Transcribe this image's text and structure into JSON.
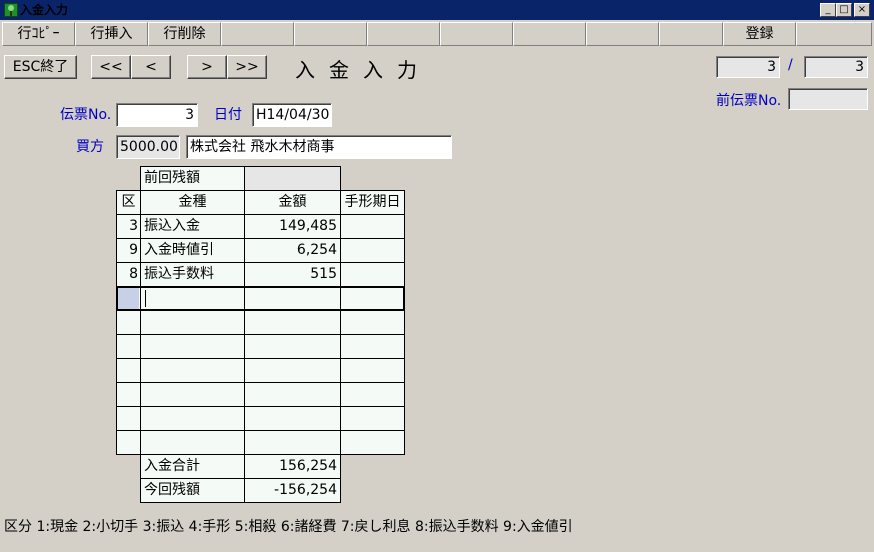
{
  "window": {
    "title": "入金入力",
    "min": "_",
    "max": "□",
    "close": "×"
  },
  "toolbar": {
    "copy_row": "行ｺﾋﾟｰ",
    "insert_row": "行挿入",
    "delete_row": "行削除",
    "register": "登録"
  },
  "nav": {
    "esc": "ESC終了",
    "first": "<<",
    "prev": "<",
    "next": ">",
    "last": ">>"
  },
  "form_title": "入金入力",
  "record": {
    "current": "3",
    "separator": "/",
    "total": "3"
  },
  "prev_slip": {
    "label": "前伝票No.",
    "value": ""
  },
  "slip_no": {
    "label": "伝票No.",
    "value": "3"
  },
  "date": {
    "label": "日付",
    "value": "H14/04/30"
  },
  "buyer": {
    "label": "買方",
    "code": "5000.00",
    "name": "株式会社 飛水木材商事"
  },
  "grid": {
    "prev_balance_label": "前回残額",
    "prev_balance_value": "",
    "headers": {
      "kubun": "区",
      "kinshu": "金種",
      "amount": "金額",
      "due": "手形期日"
    },
    "rows": [
      {
        "kubun": "3",
        "kinshu": "振込入金",
        "amount": "149,485",
        "due": ""
      },
      {
        "kubun": "9",
        "kinshu": "入金時値引",
        "amount": "6,254",
        "due": ""
      },
      {
        "kubun": "8",
        "kinshu": "振込手数料",
        "amount": "515",
        "due": ""
      },
      {
        "kubun": "",
        "kinshu": "",
        "amount": "",
        "due": ""
      },
      {
        "kubun": "",
        "kinshu": "",
        "amount": "",
        "due": ""
      },
      {
        "kubun": "",
        "kinshu": "",
        "amount": "",
        "due": ""
      },
      {
        "kubun": "",
        "kinshu": "",
        "amount": "",
        "due": ""
      },
      {
        "kubun": "",
        "kinshu": "",
        "amount": "",
        "due": ""
      },
      {
        "kubun": "",
        "kinshu": "",
        "amount": "",
        "due": ""
      },
      {
        "kubun": "",
        "kinshu": "",
        "amount": "",
        "due": ""
      }
    ],
    "total_label": "入金合計",
    "total_value": "156,254",
    "balance_label": "今回残額",
    "balance_value": "-156,254"
  },
  "legend": "区分 1:現金 2:小切手 3:振込 4:手形 5:相殺 6:諸経費 7:戻し利息 8:振込手数料 9:入金値引"
}
